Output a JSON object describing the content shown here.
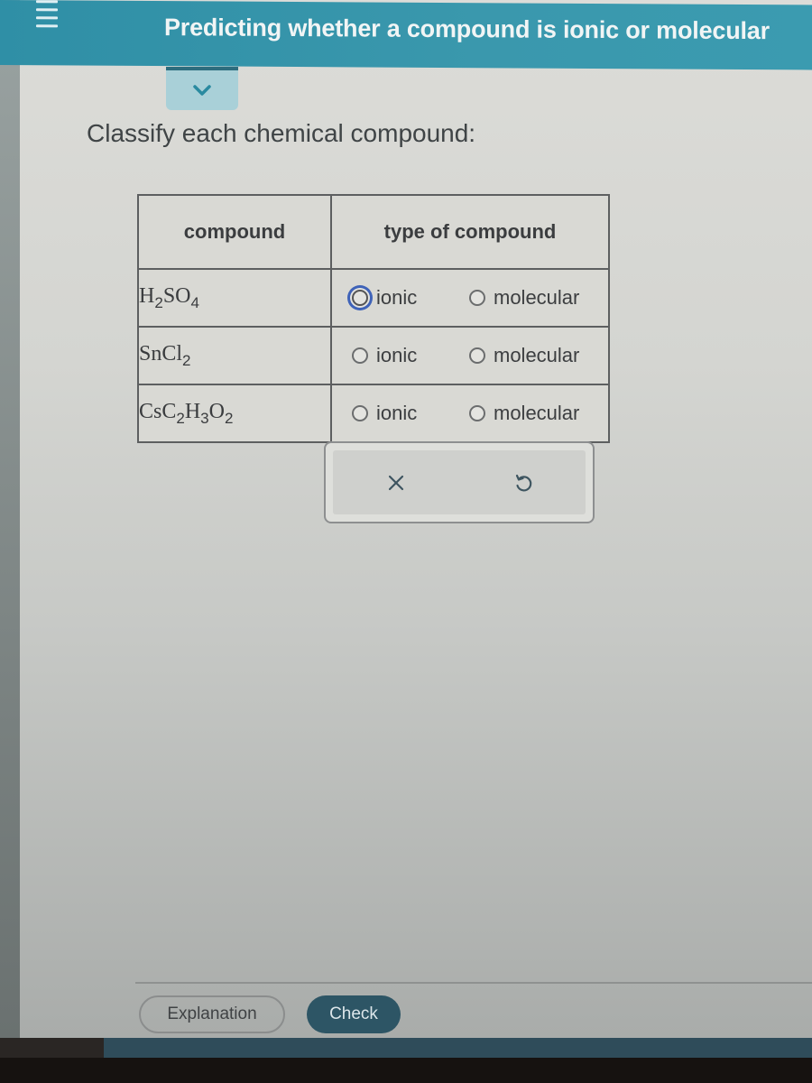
{
  "header": {
    "title": "Predicting whether a compound is ionic or molecular",
    "menu_icon": "hamburger-menu-icon",
    "background_color": "#3a98ad"
  },
  "collapse": {
    "icon": "chevron-down-icon"
  },
  "prompt": "Classify each chemical compound:",
  "table": {
    "headers": [
      "compound",
      "type of compound"
    ],
    "rows": [
      {
        "formula": [
          {
            "t": "H"
          },
          {
            "s": "2"
          },
          {
            "t": "SO"
          },
          {
            "s": "4"
          }
        ],
        "formula_text": "H2SO4",
        "options": [
          {
            "label": "ionic",
            "selected": false,
            "focused": true
          },
          {
            "label": "molecular",
            "selected": false,
            "focused": false
          }
        ]
      },
      {
        "formula": [
          {
            "t": "SnCl"
          },
          {
            "s": "2"
          }
        ],
        "formula_text": "SnCl2",
        "options": [
          {
            "label": "ionic",
            "selected": false,
            "focused": false
          },
          {
            "label": "molecular",
            "selected": false,
            "focused": false
          }
        ]
      },
      {
        "formula": [
          {
            "t": "CsC"
          },
          {
            "s": "2"
          },
          {
            "t": "H"
          },
          {
            "s": "3"
          },
          {
            "t": "O"
          },
          {
            "s": "2"
          }
        ],
        "formula_text": "CsC2H3O2",
        "options": [
          {
            "label": "ionic",
            "selected": false,
            "focused": false
          },
          {
            "label": "molecular",
            "selected": false,
            "focused": false
          }
        ]
      }
    ]
  },
  "actions": {
    "clear_icon": "x-icon",
    "undo_icon": "undo-icon"
  },
  "footer": {
    "explanation_label": "Explanation",
    "check_label": "Check",
    "check_color": "#2d5565"
  }
}
